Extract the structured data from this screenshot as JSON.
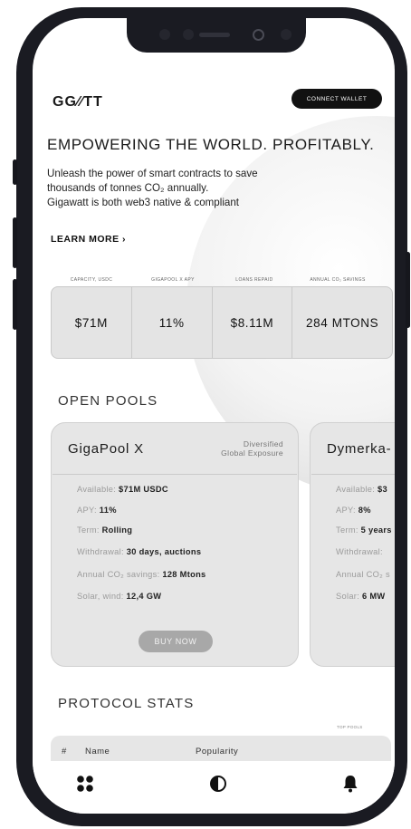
{
  "header": {
    "logo": "GG∕∕TT",
    "connect_label": "CONNECT WALLET"
  },
  "hero": {
    "title": "EMPOWERING THE WORLD. PROFITABLY.",
    "line1": "Unleash the power of smart contracts to save",
    "line2": "thousands of tonnes CO₂ annually.",
    "line3": "Gigawatt is both web3 native & compliant",
    "learn_more": "LEARN MORE ›"
  },
  "stats": [
    {
      "label": "CAPACITY, USDC",
      "value": "$71M"
    },
    {
      "label": "GIGAPOOL X APY",
      "value": "11%"
    },
    {
      "label": "LOANS REPAID",
      "value": "$8.11M"
    },
    {
      "label": "ANNUAL CO₂ SAVINGS",
      "value": "284 MTONS"
    }
  ],
  "open_pools": {
    "heading": "OPEN POOLS",
    "pools": [
      {
        "name": "GigaPool X",
        "region_line1": "Diversified",
        "region_line2": "Global Exposure",
        "available_label": "Available: ",
        "available_value": "$71M USDC",
        "apy_label": "APY: ",
        "apy_value": "11%",
        "term_label": "Term: ",
        "term_value": "Rolling",
        "withdrawal_label": "Withdrawal: ",
        "withdrawal_value": "30 days, auctions",
        "co2_label": "Annual CO₂ savings: ",
        "co2_value": "128 Mtons",
        "solar_label": "Solar, wind: ",
        "solar_value": "12,4 GW",
        "buy_label": "BUY NOW"
      },
      {
        "name": "Dymerka-",
        "available_label": "Available: ",
        "available_value": "$3",
        "apy_label": "APY: ",
        "apy_value": "8%",
        "term_label": "Term: ",
        "term_value": "5 years",
        "withdrawal_label": "Withdrawal:",
        "co2_label": "Annual CO₂ s",
        "solar_label": "Solar: ",
        "solar_value": "6 MW"
      }
    ]
  },
  "protocol_stats": {
    "heading": "PROTOCOL STATS",
    "top_pools_label": "TOP POOLS",
    "columns": [
      "#",
      "Name",
      "Popularity"
    ]
  },
  "tabbar": {
    "icons": [
      "grid-icon",
      "contrast-icon",
      "bell-icon"
    ]
  }
}
